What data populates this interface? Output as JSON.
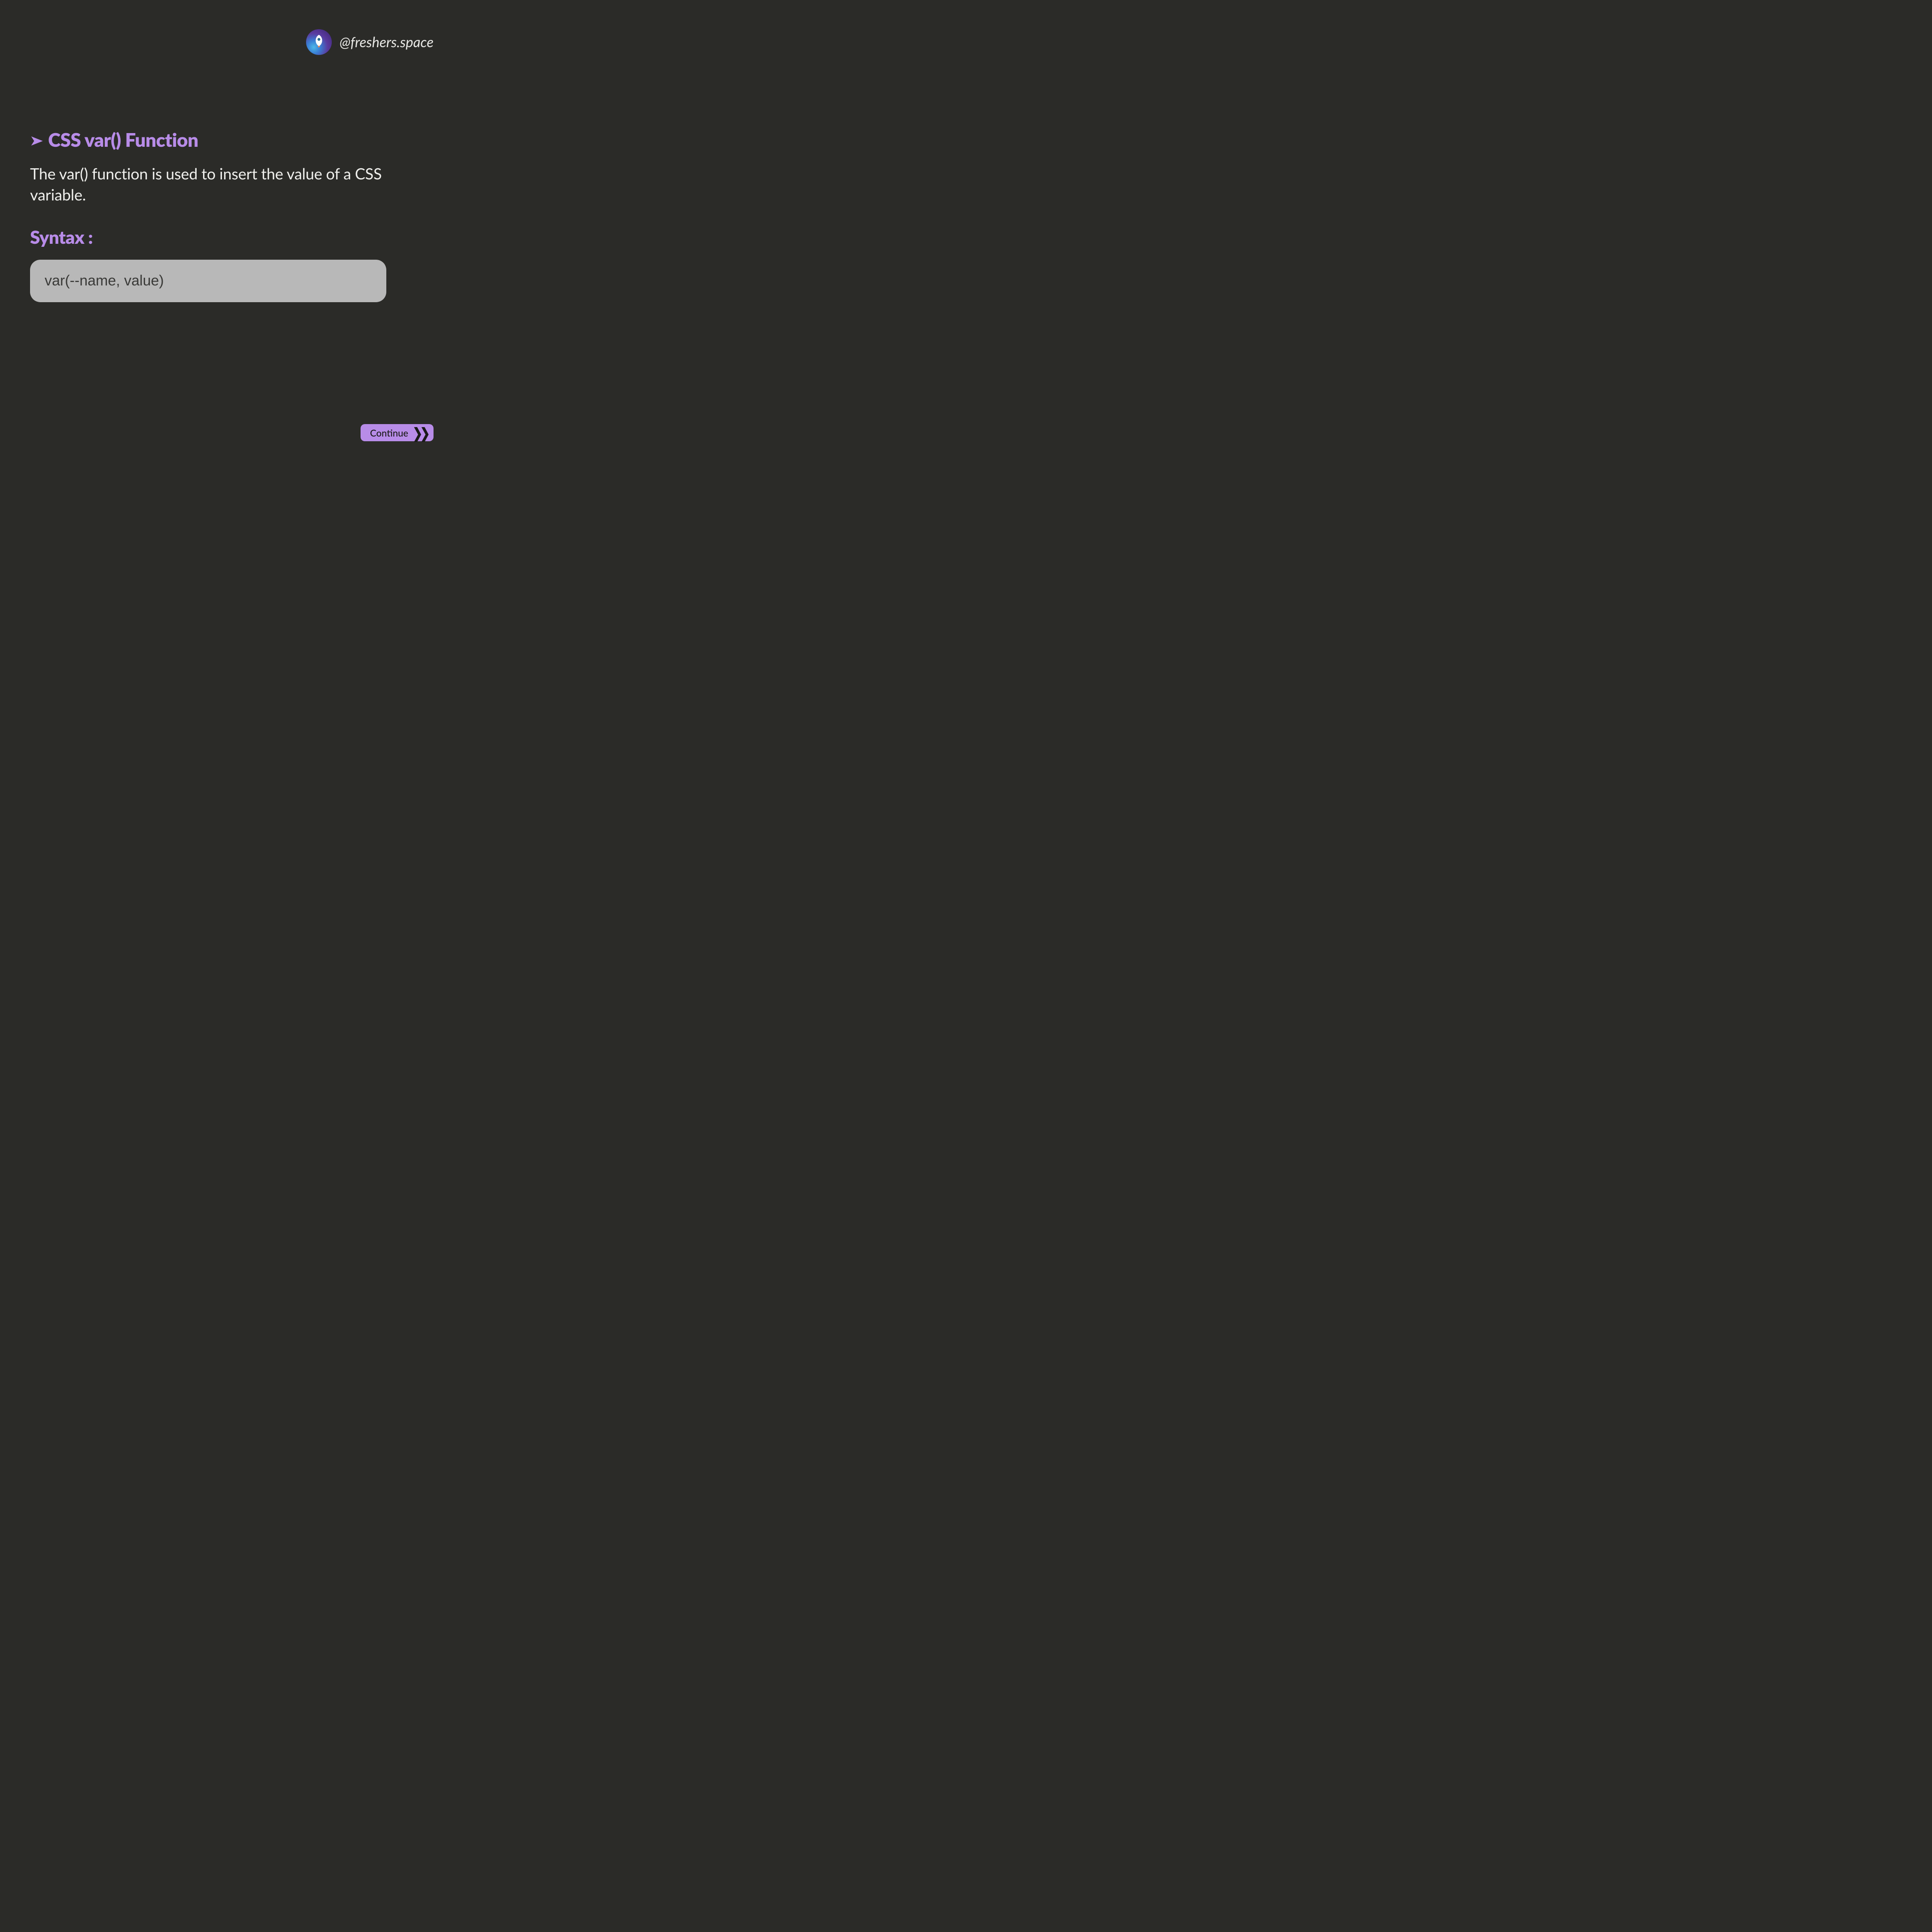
{
  "header": {
    "handle": "@freshers.space"
  },
  "content": {
    "title": "CSS var() Function",
    "description": "The var() function is used to insert the value of a CSS variable.",
    "syntax_label": "Syntax :",
    "syntax_code": "var(--name, value)"
  },
  "footer": {
    "continue_label": "Continue"
  },
  "colors": {
    "background": "#2b2b28",
    "accent": "#b88ce8",
    "text_light": "#f0f0ed",
    "code_bg": "#b8b8b8",
    "code_text": "#3a3a38"
  }
}
